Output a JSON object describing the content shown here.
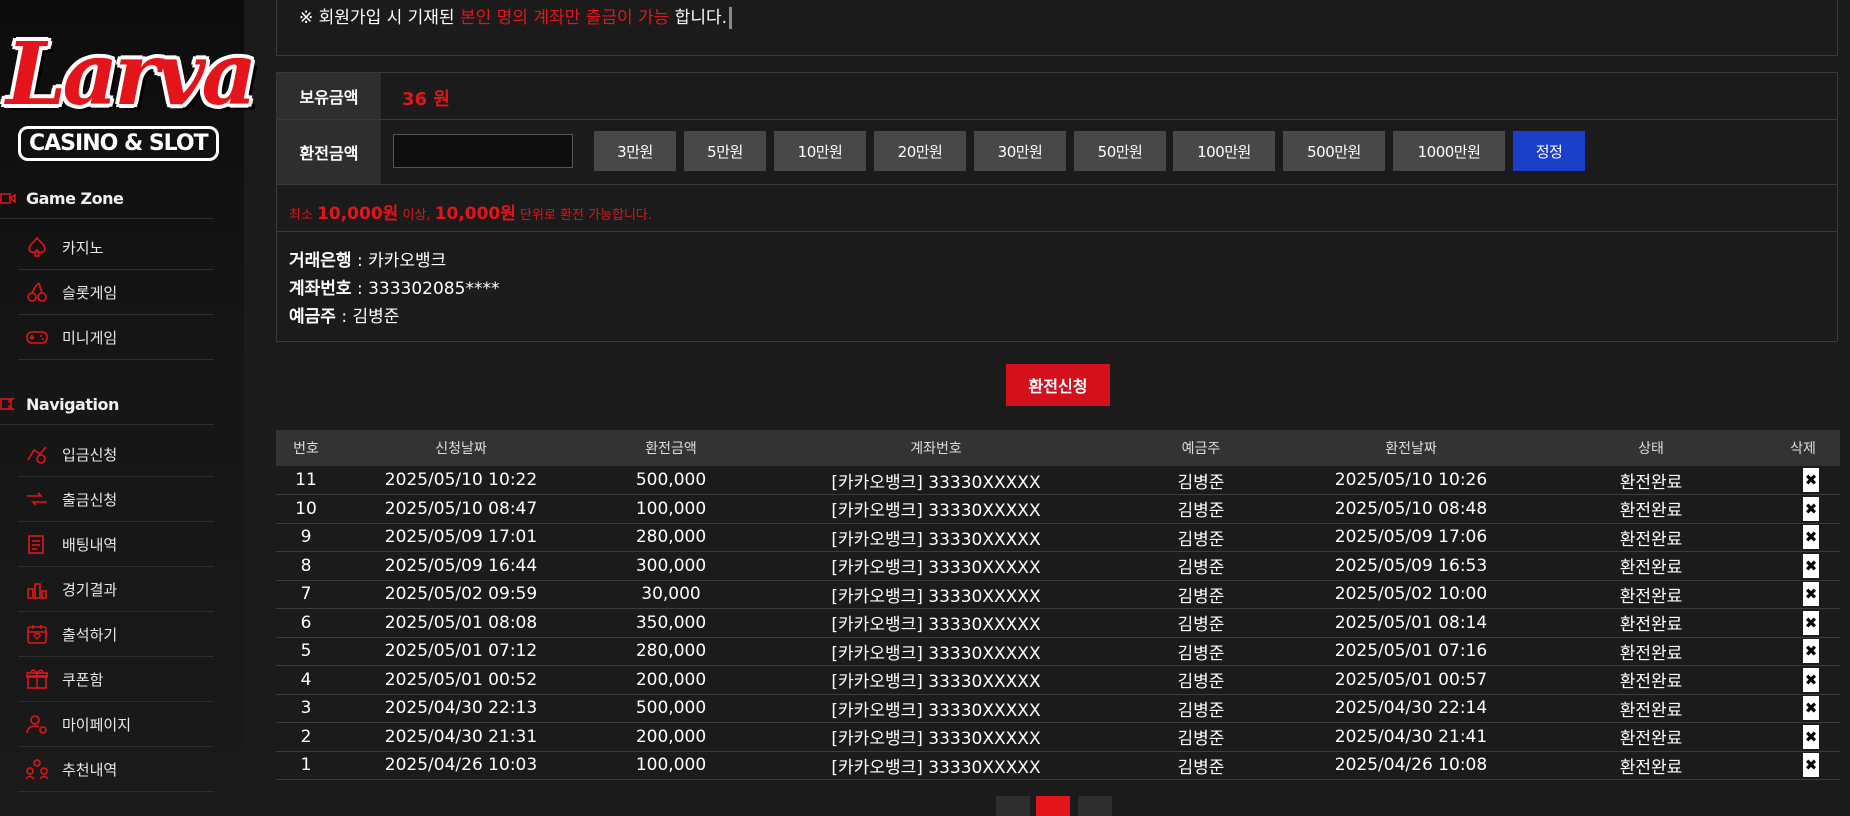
{
  "logo": {
    "main": "Larva",
    "sub": "CASINO & SLOT"
  },
  "sidebar": {
    "game_zone": {
      "title": "Game Zone",
      "items": [
        {
          "label": "카지노",
          "icon": "spade-icon"
        },
        {
          "label": "슬롯게임",
          "icon": "cherry-icon"
        },
        {
          "label": "미니게임",
          "icon": "gamepad-icon"
        }
      ]
    },
    "navigation": {
      "title": "Navigation",
      "items": [
        {
          "label": "입금신청",
          "icon": "deposit-icon"
        },
        {
          "label": "출금신청",
          "icon": "withdraw-icon"
        },
        {
          "label": "배팅내역",
          "icon": "bet-history-icon"
        },
        {
          "label": "경기결과",
          "icon": "results-icon"
        },
        {
          "label": "출석하기",
          "icon": "calendar-icon"
        },
        {
          "label": "쿠폰함",
          "icon": "coupon-box-icon"
        },
        {
          "label": "마이페이지",
          "icon": "user-gear-icon"
        },
        {
          "label": "추천내역",
          "icon": "referral-icon"
        }
      ]
    }
  },
  "notice": {
    "prefix": "※ 회원가입 시 기재된 ",
    "highlight": "본인 명의 계좌만 출금이 가능",
    "suffix": " 합니다."
  },
  "form": {
    "balance_label": "보유금액",
    "balance_value": "36 원",
    "amount_label": "환전금액",
    "amount_value": "",
    "amount_buttons": [
      "3만원",
      "5만원",
      "10만원",
      "20만원",
      "30만원",
      "50만원",
      "100만원",
      "500만원",
      "1000만원"
    ],
    "reset_label": "정정",
    "min_text": {
      "p1": "최소 ",
      "b1": "10,000원",
      "p2": " 이상, ",
      "b2": "10,000원",
      "p3": " 단위로 환전 가능합니다."
    },
    "bank": {
      "bank_label": "거래은행",
      "bank_value": " : 카카오뱅크",
      "account_label": "계좌번호",
      "account_value": " : 333302085****",
      "holder_label": "예금주",
      "holder_value": " : 김병준"
    },
    "submit_label": "환전신청"
  },
  "table": {
    "headers": [
      "번호",
      "신청날짜",
      "환전금액",
      "계좌번호",
      "예금주",
      "환전날짜",
      "상태",
      "삭제"
    ],
    "rows": [
      {
        "no": "11",
        "req": "2025/05/10 10:22",
        "amount": "500,000",
        "account": "[카카오뱅크] 33330XXXXX",
        "holder": "김병준",
        "done": "2025/05/10 10:26",
        "status": "환전완료"
      },
      {
        "no": "10",
        "req": "2025/05/10 08:47",
        "amount": "100,000",
        "account": "[카카오뱅크] 33330XXXXX",
        "holder": "김병준",
        "done": "2025/05/10 08:48",
        "status": "환전완료"
      },
      {
        "no": "9",
        "req": "2025/05/09 17:01",
        "amount": "280,000",
        "account": "[카카오뱅크] 33330XXXXX",
        "holder": "김병준",
        "done": "2025/05/09 17:06",
        "status": "환전완료"
      },
      {
        "no": "8",
        "req": "2025/05/09 16:44",
        "amount": "300,000",
        "account": "[카카오뱅크] 33330XXXXX",
        "holder": "김병준",
        "done": "2025/05/09 16:53",
        "status": "환전완료"
      },
      {
        "no": "7",
        "req": "2025/05/02 09:59",
        "amount": "30,000",
        "account": "[카카오뱅크] 33330XXXXX",
        "holder": "김병준",
        "done": "2025/05/02 10:00",
        "status": "환전완료"
      },
      {
        "no": "6",
        "req": "2025/05/01 08:08",
        "amount": "350,000",
        "account": "[카카오뱅크] 33330XXXXX",
        "holder": "김병준",
        "done": "2025/05/01 08:14",
        "status": "환전완료"
      },
      {
        "no": "5",
        "req": "2025/05/01 07:12",
        "amount": "280,000",
        "account": "[카카오뱅크] 33330XXXXX",
        "holder": "김병준",
        "done": "2025/05/01 07:16",
        "status": "환전완료"
      },
      {
        "no": "4",
        "req": "2025/05/01 00:52",
        "amount": "200,000",
        "account": "[카카오뱅크] 33330XXXXX",
        "holder": "김병준",
        "done": "2025/05/01 00:57",
        "status": "환전완료"
      },
      {
        "no": "3",
        "req": "2025/04/30 22:13",
        "amount": "500,000",
        "account": "[카카오뱅크] 33330XXXXX",
        "holder": "김병준",
        "done": "2025/04/30 22:14",
        "status": "환전완료"
      },
      {
        "no": "2",
        "req": "2025/04/30 21:31",
        "amount": "200,000",
        "account": "[카카오뱅크] 33330XXXXX",
        "holder": "김병준",
        "done": "2025/04/30 21:41",
        "status": "환전완료"
      },
      {
        "no": "1",
        "req": "2025/04/26 10:03",
        "amount": "100,000",
        "account": "[카카오뱅크] 33330XXXXX",
        "holder": "김병준",
        "done": "2025/04/26 10:08",
        "status": "환전완료"
      }
    ],
    "delete_glyph": "✖"
  },
  "colors": {
    "accent_red": "#e3151a",
    "button_blue": "#1a3fc9",
    "submit_red": "#d4101d"
  }
}
